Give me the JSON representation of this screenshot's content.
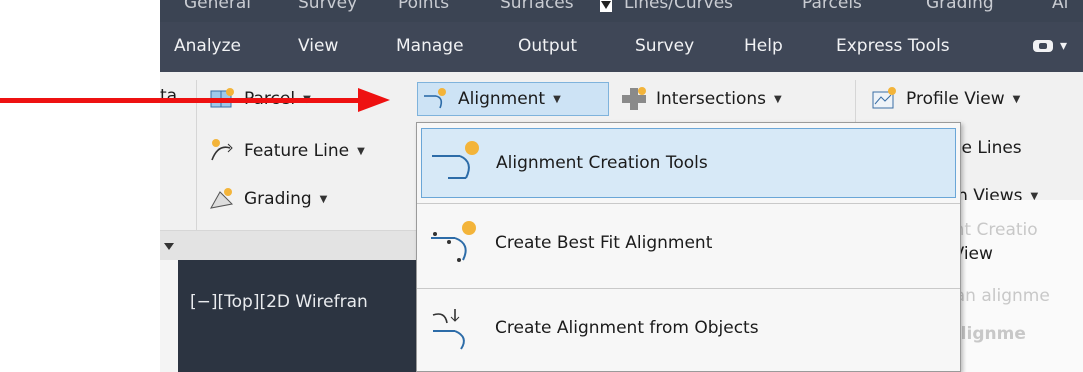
{
  "tabs": [
    "General",
    "Survey",
    "Points",
    "Surfaces",
    "Lines/Curves",
    "Parcels",
    "Grading",
    "Al"
  ],
  "menu": [
    "Analyze",
    "View",
    "Manage",
    "Output",
    "Survey",
    "Help",
    "Express Tools"
  ],
  "ribbon": {
    "cut_left": "ta",
    "parcel": "Parcel",
    "feature_line": "Feature Line",
    "grading": "Grading",
    "alignment": "Alignment",
    "intersections": "Intersections",
    "profile_view": "Profile View",
    "sample_lines": "ple Lines",
    "section_views": "ion Views"
  },
  "dropdown": {
    "items": [
      "Alignment Creation Tools",
      "Create Best Fit Alignment",
      "Create Alignment from Objects"
    ]
  },
  "tooltip": {
    "title": "Alignment Creatio",
    "section_view": "Section View",
    "desc": "Creates an alignme",
    "command": "CreateAlignme"
  },
  "viewport": {
    "label": "[−][Top][2D Wirefran"
  },
  "icons": [
    "parcel-icon",
    "feature-line-icon",
    "grading-icon",
    "alignment-icon",
    "intersections-icon",
    "profile-view-icon",
    "cloud-icon"
  ],
  "colors": {
    "menu_bg": "#3f4757",
    "highlight": "#cde3f5",
    "arrow": "#ee1111"
  }
}
